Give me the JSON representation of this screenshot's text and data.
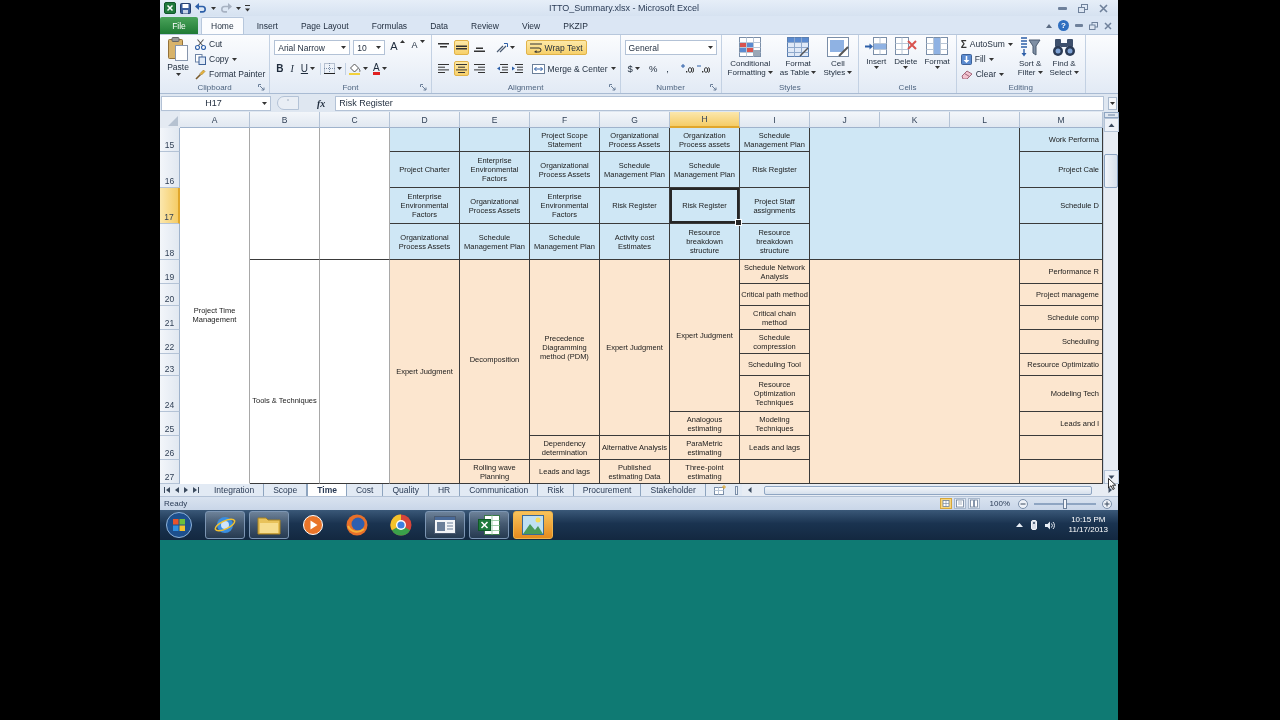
{
  "title_bar": {
    "title": "ITTO_Summary.xlsx - Microsoft Excel"
  },
  "ribbon_tabs": [
    {
      "label": "File",
      "kind": "file",
      "selected": false
    },
    {
      "label": "Home",
      "kind": "tab",
      "selected": true
    },
    {
      "label": "Insert",
      "kind": "tab",
      "selected": false
    },
    {
      "label": "Page Layout",
      "kind": "tab",
      "selected": false
    },
    {
      "label": "Formulas",
      "kind": "tab",
      "selected": false
    },
    {
      "label": "Data",
      "kind": "tab",
      "selected": false
    },
    {
      "label": "Review",
      "kind": "tab",
      "selected": false
    },
    {
      "label": "View",
      "kind": "tab",
      "selected": false
    },
    {
      "label": "PKZIP",
      "kind": "tab",
      "selected": false
    }
  ],
  "help_button": "?",
  "clipboard": {
    "title": "Clipboard",
    "paste": "Paste",
    "cut": "Cut",
    "copy": "Copy",
    "format_painter": "Format Painter"
  },
  "font": {
    "title": "Font",
    "font_name": "Arial Narrow",
    "font_size": "10",
    "grow": "A",
    "shrink": "A",
    "bold": "B",
    "italic": "I",
    "underline": "U",
    "font_color": "A"
  },
  "alignment": {
    "title": "Alignment",
    "vertical": [
      {
        "selected": false
      },
      {
        "selected": true
      },
      {
        "selected": false
      }
    ],
    "wrap_text": {
      "label": "Wrap Text",
      "on": true
    },
    "horizontal": [
      {
        "selected": false
      },
      {
        "selected": true
      },
      {
        "selected": false
      }
    ],
    "merge": "Merge & Center"
  },
  "number": {
    "title": "Number",
    "format": "General",
    "currency": "$",
    "percent": "%",
    "comma": ","
  },
  "styles": {
    "title": "Styles",
    "buttons": [
      {
        "kind": "conditional",
        "lines": [
          "Conditional",
          "Formatting"
        ]
      },
      {
        "kind": "table",
        "lines": [
          "Format",
          "as Table"
        ]
      },
      {
        "kind": "cell_styles",
        "lines": [
          "Cell",
          "Styles"
        ]
      }
    ]
  },
  "cells": {
    "title": "Cells",
    "buttons": [
      {
        "kind": "insert",
        "label": "Insert"
      },
      {
        "kind": "delete",
        "label": "Delete"
      },
      {
        "kind": "format",
        "label": "Format"
      }
    ]
  },
  "editing": {
    "title": "Editing",
    "autosum": {
      "symbol": "Σ",
      "label": "AutoSum"
    },
    "fill": "Fill",
    "clear": "Clear",
    "buttons": [
      {
        "kind": "sort",
        "lines": [
          "Sort &",
          "Filter"
        ]
      },
      {
        "kind": "find",
        "lines": [
          "Find &",
          "Select"
        ]
      }
    ]
  },
  "formula_bar": {
    "name_box": "H17",
    "fx": "fx",
    "formula": "Risk Register"
  },
  "sheet": {
    "rows": [
      {
        "label": "15",
        "selected": false
      },
      {
        "label": "16",
        "selected": false
      },
      {
        "label": "17",
        "selected": true
      },
      {
        "label": "18",
        "selected": false
      },
      {
        "label": "19",
        "selected": false
      },
      {
        "label": "20",
        "selected": false
      },
      {
        "label": "21",
        "selected": false
      },
      {
        "label": "22",
        "selected": false
      },
      {
        "label": "23",
        "selected": false
      },
      {
        "label": "24",
        "selected": false
      },
      {
        "label": "25",
        "selected": false
      },
      {
        "label": "26",
        "selected": false
      },
      {
        "label": "27",
        "selected": false
      }
    ],
    "columns": [
      {
        "label": "A",
        "selected": false,
        "cells": [
          {
            "kind": "cell",
            "selected": false,
            "text": "Project Time Management"
          },
          {
            "kind": "merge_up"
          },
          {
            "kind": "merge_up"
          },
          {
            "kind": "merge_up"
          },
          {
            "kind": "merge_up"
          },
          {
            "kind": "merge_up"
          },
          {
            "kind": "merge_up"
          },
          {
            "kind": "merge_up"
          },
          {
            "kind": "merge_up"
          },
          {
            "kind": "merge_up"
          },
          {
            "kind": "merge_up"
          },
          {
            "kind": "merge_up"
          },
          {
            "kind": "merge_up"
          }
        ]
      },
      {
        "label": "B",
        "selected": false,
        "cells": [
          {
            "kind": "cell",
            "selected": false
          },
          {
            "kind": "merge_up"
          },
          {
            "kind": "merge_up"
          },
          {
            "kind": "merge_up"
          },
          {
            "kind": "cell",
            "selected": false,
            "text": "Tools & Techniques"
          },
          {
            "kind": "merge_up"
          },
          {
            "kind": "merge_up"
          },
          {
            "kind": "merge_up"
          },
          {
            "kind": "merge_up"
          },
          {
            "kind": "merge_up"
          },
          {
            "kind": "merge_up"
          },
          {
            "kind": "merge_up"
          },
          {
            "kind": "merge_up"
          }
        ]
      },
      {
        "label": "C",
        "selected": false,
        "cells": [
          {
            "kind": "cell",
            "selected": false
          },
          {
            "kind": "merge_up"
          },
          {
            "kind": "merge_up"
          },
          {
            "kind": "merge_up"
          },
          {
            "kind": "cell",
            "selected": false
          },
          {
            "kind": "merge_up"
          },
          {
            "kind": "merge_up"
          },
          {
            "kind": "merge_up"
          },
          {
            "kind": "merge_up"
          },
          {
            "kind": "merge_up"
          },
          {
            "kind": "merge_up"
          },
          {
            "kind": "merge_up"
          },
          {
            "kind": "merge_up"
          }
        ]
      },
      {
        "label": "D",
        "selected": false,
        "cells": [
          {
            "kind": "cell",
            "color": "#cfe7f5",
            "selected": false
          },
          {
            "kind": "cell",
            "color": "#cfe7f5",
            "selected": false,
            "text": "Project Charter"
          },
          {
            "kind": "cell",
            "color": "#cfe7f5",
            "selected": false,
            "text": "Enterprise Environmental Factors"
          },
          {
            "kind": "cell",
            "color": "#cfe7f5",
            "selected": false,
            "text": "Organizational Process Assets"
          },
          {
            "kind": "cell",
            "color": "#fce6cf",
            "selected": false,
            "text": "Expert Judgment"
          },
          {
            "kind": "merge_up"
          },
          {
            "kind": "merge_up"
          },
          {
            "kind": "merge_up"
          },
          {
            "kind": "merge_up"
          },
          {
            "kind": "merge_up"
          },
          {
            "kind": "merge_up"
          },
          {
            "kind": "merge_up"
          },
          {
            "kind": "merge_up"
          }
        ]
      },
      {
        "label": "E",
        "selected": false,
        "cells": [
          {
            "kind": "cell",
            "color": "#cfe7f5",
            "selected": false
          },
          {
            "kind": "cell",
            "color": "#cfe7f5",
            "selected": false,
            "text": "Enterprise Environmental Factors"
          },
          {
            "kind": "cell",
            "color": "#cfe7f5",
            "selected": false,
            "text": "Organizational Process Assets"
          },
          {
            "kind": "cell",
            "color": "#cfe7f5",
            "selected": false,
            "text": "Schedule Management Plan"
          },
          {
            "kind": "cell",
            "color": "#fce6cf",
            "selected": false,
            "text": "Decomposition"
          },
          {
            "kind": "merge_up"
          },
          {
            "kind": "merge_up"
          },
          {
            "kind": "merge_up"
          },
          {
            "kind": "merge_up"
          },
          {
            "kind": "merge_up"
          },
          {
            "kind": "merge_up"
          },
          {
            "kind": "merge_up"
          },
          {
            "kind": "cell",
            "color": "#fce6cf",
            "selected": false,
            "text": "Rolling wave Planning"
          }
        ]
      },
      {
        "label": "F",
        "selected": false,
        "cells": [
          {
            "kind": "cell",
            "color": "#cfe7f5",
            "selected": false,
            "text": "Project Scope Statement"
          },
          {
            "kind": "cell",
            "color": "#cfe7f5",
            "selected": false,
            "text": "Organizational Process Assets"
          },
          {
            "kind": "cell",
            "color": "#cfe7f5",
            "selected": false,
            "text": "Enterprise Environmental Factors"
          },
          {
            "kind": "cell",
            "color": "#cfe7f5",
            "selected": false,
            "text": "Schedule Management Plan"
          },
          {
            "kind": "cell",
            "color": "#fce6cf",
            "selected": false,
            "text": "Precedence Diagramming method (PDM)"
          },
          {
            "kind": "merge_up"
          },
          {
            "kind": "merge_up"
          },
          {
            "kind": "merge_up"
          },
          {
            "kind": "merge_up"
          },
          {
            "kind": "merge_up"
          },
          {
            "kind": "merge_up"
          },
          {
            "kind": "cell",
            "color": "#fce6cf",
            "selected": false,
            "text": "Dependency determination"
          },
          {
            "kind": "cell",
            "color": "#fce6cf",
            "selected": false,
            "text": "Leads and lags"
          }
        ]
      },
      {
        "label": "G",
        "selected": false,
        "cells": [
          {
            "kind": "cell",
            "color": "#cfe7f5",
            "selected": false,
            "text": "Organizational Process Assets"
          },
          {
            "kind": "cell",
            "color": "#cfe7f5",
            "selected": false,
            "text": "Schedule Management Plan"
          },
          {
            "kind": "cell",
            "color": "#cfe7f5",
            "selected": false,
            "text": "Risk Register"
          },
          {
            "kind": "cell",
            "color": "#cfe7f5",
            "selected": false,
            "text": "Activity cost Estimates"
          },
          {
            "kind": "cell",
            "color": "#fce6cf",
            "selected": false,
            "text": "Expert Judgment"
          },
          {
            "kind": "merge_up"
          },
          {
            "kind": "merge_up"
          },
          {
            "kind": "merge_up"
          },
          {
            "kind": "merge_up"
          },
          {
            "kind": "merge_up"
          },
          {
            "kind": "merge_up"
          },
          {
            "kind": "cell",
            "color": "#fce6cf",
            "selected": false,
            "text": "Alternative Analysis"
          },
          {
            "kind": "cell",
            "color": "#fce6cf",
            "selected": false,
            "text": "Published estimating Data"
          }
        ]
      },
      {
        "label": "H",
        "selected": true,
        "cells": [
          {
            "kind": "cell",
            "color": "#cfe7f5",
            "selected": false,
            "text": "Organization Process assets"
          },
          {
            "kind": "cell",
            "color": "#cfe7f5",
            "selected": false,
            "text": "Schedule Management Plan"
          },
          {
            "kind": "cell",
            "color": "#cfe7f5",
            "selected": true,
            "text": "Risk Register"
          },
          {
            "kind": "cell",
            "color": "#cfe7f5",
            "selected": false,
            "text": "Resource breakdown structure"
          },
          {
            "kind": "cell",
            "color": "#fce6cf",
            "selected": false,
            "text": "Expert Judgment"
          },
          {
            "kind": "merge_up"
          },
          {
            "kind": "merge_up"
          },
          {
            "kind": "merge_up"
          },
          {
            "kind": "merge_up"
          },
          {
            "kind": "merge_up"
          },
          {
            "kind": "cell",
            "color": "#fce6cf",
            "selected": false,
            "text": "Analogous estimating"
          },
          {
            "kind": "cell",
            "color": "#fce6cf",
            "selected": false,
            "text": "ParaMetric estimating"
          },
          {
            "kind": "cell",
            "color": "#fce6cf",
            "selected": false,
            "text": "Three-point estimating"
          }
        ]
      },
      {
        "label": "I",
        "selected": false,
        "cells": [
          {
            "kind": "cell",
            "color": "#cfe7f5",
            "selected": false,
            "text": "Schedule Management Plan"
          },
          {
            "kind": "cell",
            "color": "#cfe7f5",
            "selected": false,
            "text": "Risk Register"
          },
          {
            "kind": "cell",
            "color": "#cfe7f5",
            "selected": false,
            "text": "Project Staff assignments"
          },
          {
            "kind": "cell",
            "color": "#cfe7f5",
            "selected": false,
            "text": "Resource breakdown structure"
          },
          {
            "kind": "cell",
            "color": "#fce6cf",
            "selected": false,
            "text": "Schedule Network Analysis"
          },
          {
            "kind": "cell",
            "color": "#fce6cf",
            "selected": false,
            "text": "Critical path method"
          },
          {
            "kind": "cell",
            "color": "#fce6cf",
            "selected": false,
            "text": "Critical chain method"
          },
          {
            "kind": "cell",
            "color": "#fce6cf",
            "selected": false,
            "text": "Schedule compression"
          },
          {
            "kind": "cell",
            "color": "#fce6cf",
            "selected": false,
            "text": "Scheduling Tool"
          },
          {
            "kind": "cell",
            "color": "#fce6cf",
            "selected": false,
            "text": "Resource Optimization Techniques"
          },
          {
            "kind": "cell",
            "color": "#fce6cf",
            "selected": false,
            "text": "Modeling Techniques"
          },
          {
            "kind": "cell",
            "color": "#fce6cf",
            "selected": false,
            "text": "Leads and lags"
          },
          {
            "kind": "cell",
            "color": "#fce6cf",
            "selected": false
          }
        ]
      },
      {
        "label": "J",
        "selected": false,
        "cells": [
          {
            "kind": "cell",
            "color": "#cfe7f5",
            "selected": false
          },
          {
            "kind": "merge_up"
          },
          {
            "kind": "merge_up"
          },
          {
            "kind": "merge_up"
          },
          {
            "kind": "cell",
            "color": "#fce6cf",
            "selected": false
          },
          {
            "kind": "merge_up"
          },
          {
            "kind": "merge_up"
          },
          {
            "kind": "merge_up"
          },
          {
            "kind": "merge_up"
          },
          {
            "kind": "merge_up"
          },
          {
            "kind": "merge_up"
          },
          {
            "kind": "merge_up"
          },
          {
            "kind": "merge_up"
          }
        ]
      },
      {
        "label": "K",
        "selected": false,
        "cells": [
          {
            "kind": "merge_left"
          },
          {
            "kind": "merge_up"
          },
          {
            "kind": "merge_up"
          },
          {
            "kind": "merge_up"
          },
          {
            "kind": "merge_left"
          },
          {
            "kind": "merge_up"
          },
          {
            "kind": "merge_up"
          },
          {
            "kind": "merge_up"
          },
          {
            "kind": "merge_up"
          },
          {
            "kind": "merge_up"
          },
          {
            "kind": "merge_up"
          },
          {
            "kind": "merge_up"
          },
          {
            "kind": "merge_up"
          }
        ]
      },
      {
        "label": "L",
        "selected": false,
        "cells": [
          {
            "kind": "merge_left"
          },
          {
            "kind": "merge_up"
          },
          {
            "kind": "merge_up"
          },
          {
            "kind": "merge_up"
          },
          {
            "kind": "merge_left"
          },
          {
            "kind": "merge_up"
          },
          {
            "kind": "merge_up"
          },
          {
            "kind": "merge_up"
          },
          {
            "kind": "merge_up"
          },
          {
            "kind": "merge_up"
          },
          {
            "kind": "merge_up"
          },
          {
            "kind": "merge_up"
          },
          {
            "kind": "merge_up"
          }
        ]
      },
      {
        "label": "M",
        "selected": false,
        "cells": [
          {
            "kind": "cell",
            "color": "#cfe7f5",
            "selected": false,
            "text": "Work Performa"
          },
          {
            "kind": "cell",
            "color": "#cfe7f5",
            "selected": false,
            "text": "Project Cale"
          },
          {
            "kind": "cell",
            "color": "#cfe7f5",
            "selected": false,
            "text": "Schedule D"
          },
          {
            "kind": "cell",
            "color": "#cfe7f5",
            "selected": false
          },
          {
            "kind": "cell",
            "color": "#fce6cf",
            "selected": false,
            "text": "Performance R"
          },
          {
            "kind": "cell",
            "color": "#fce6cf",
            "selected": false,
            "text": "Project manageme"
          },
          {
            "kind": "cell",
            "color": "#fce6cf",
            "selected": false,
            "text": "Schedule comp"
          },
          {
            "kind": "cell",
            "color": "#fce6cf",
            "selected": false,
            "text": "Scheduling"
          },
          {
            "kind": "cell",
            "color": "#fce6cf",
            "selected": false,
            "text": "Resource Optimizatio"
          },
          {
            "kind": "cell",
            "color": "#fce6cf",
            "selected": false,
            "text": "Modeling Tech"
          },
          {
            "kind": "cell",
            "color": "#fce6cf",
            "selected": false,
            "text": "Leads and l"
          },
          {
            "kind": "cell",
            "color": "#fce6cf",
            "selected": false
          },
          {
            "kind": "cell",
            "color": "#fce6cf",
            "selected": false
          }
        ]
      }
    ]
  },
  "sheet_tabs": [
    {
      "label": "Integration",
      "selected": false
    },
    {
      "label": "Scope",
      "selected": false
    },
    {
      "label": "Time",
      "selected": true
    },
    {
      "label": "Cost",
      "selected": false
    },
    {
      "label": "Quality",
      "selected": false
    },
    {
      "label": "HR",
      "selected": false
    },
    {
      "label": "Communication",
      "selected": false
    },
    {
      "label": "Risk",
      "selected": false
    },
    {
      "label": "Procurement",
      "selected": false
    },
    {
      "label": "Stakeholder",
      "selected": false
    }
  ],
  "status_bar": {
    "status": "Ready",
    "views": [
      {
        "kind": "normal",
        "selected": true
      },
      {
        "kind": "page_layout",
        "selected": false
      },
      {
        "kind": "page_break",
        "selected": false
      }
    ],
    "zoom": "100%",
    "zoom_slider": {
      "level": 0.5
    }
  },
  "taskbar": {
    "apps": [
      {
        "kind": "globe",
        "running": true,
        "flashing": false
      },
      {
        "kind": "folder",
        "running": true,
        "flashing": false
      },
      {
        "kind": "player",
        "running": false,
        "flashing": false
      },
      {
        "kind": "fox",
        "running": false,
        "flashing": false
      },
      {
        "kind": "wheel",
        "running": false,
        "flashing": false
      },
      {
        "kind": "window",
        "running": true,
        "flashing": false
      },
      {
        "kind": "sheet",
        "running": true,
        "flashing": false
      },
      {
        "kind": "picture",
        "running": false,
        "flashing": true
      }
    ],
    "time": "10:15 PM",
    "date": "11/17/2013"
  }
}
